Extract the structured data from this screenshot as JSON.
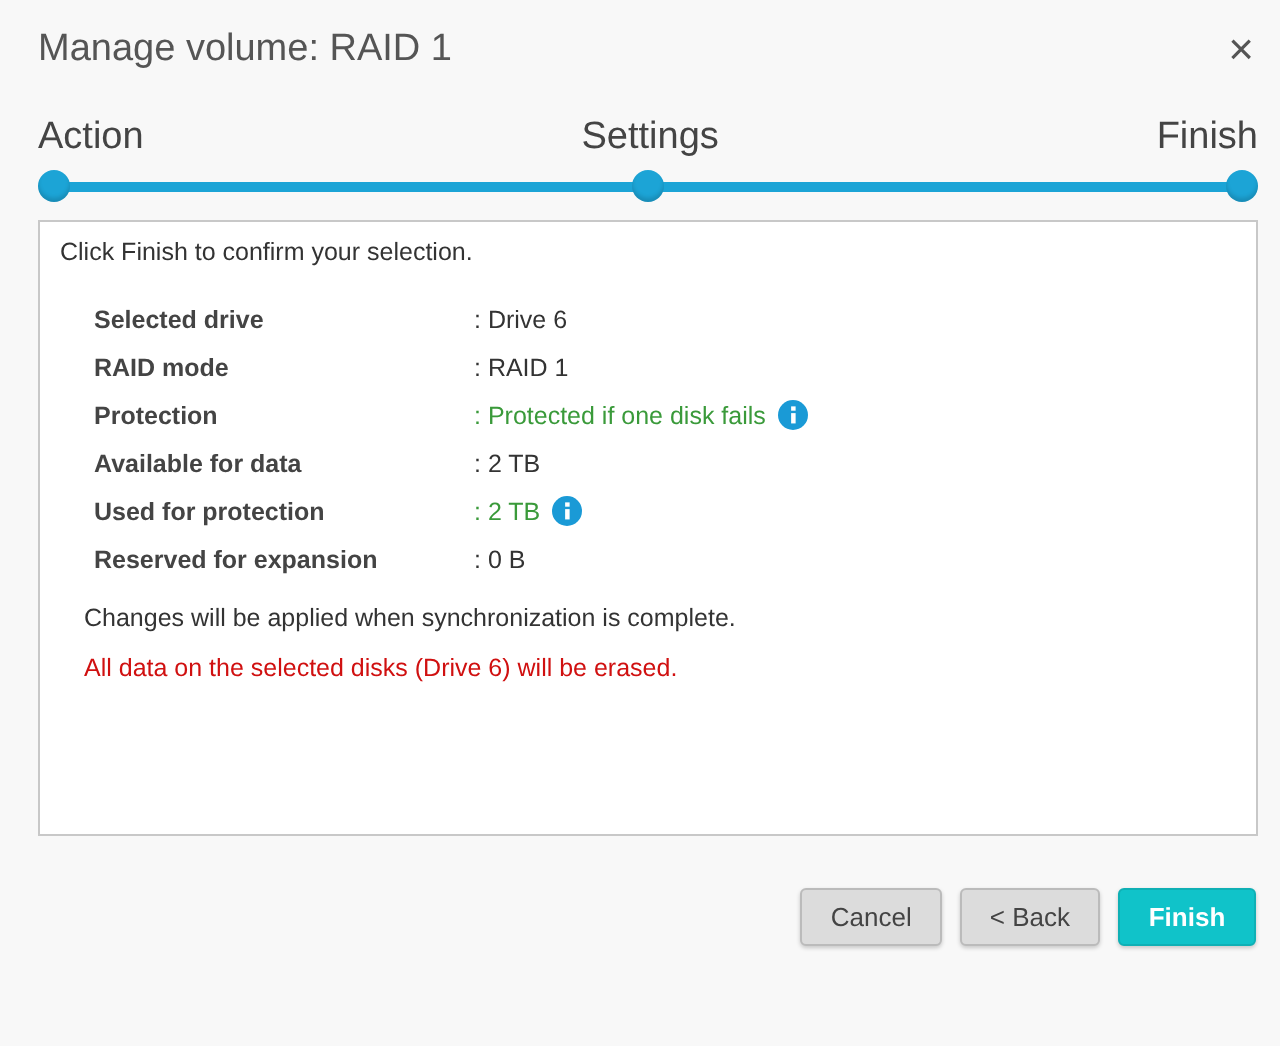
{
  "window": {
    "title": "Manage volume: RAID 1",
    "close": "×"
  },
  "steps": {
    "items": [
      {
        "label": "Action",
        "done": true
      },
      {
        "label": "Settings",
        "done": true
      },
      {
        "label": "Finish",
        "done": true
      }
    ]
  },
  "summary": {
    "intro": "Click Finish to confirm your selection.",
    "rows": [
      {
        "label": "Selected drive",
        "value": ": Drive 6",
        "highlighted": false,
        "info": false
      },
      {
        "label": "RAID mode",
        "value": ": RAID 1",
        "highlighted": false,
        "info": false
      },
      {
        "label": "Protection",
        "value": ": Protected if one disk fails",
        "highlighted": true,
        "info": true
      },
      {
        "label": "Available for data",
        "value": ": 2 TB",
        "highlighted": false,
        "info": false
      },
      {
        "label": "Used for protection",
        "value": ": 2 TB",
        "highlighted": true,
        "info": true
      },
      {
        "label": "Reserved for expansion",
        "value": ": 0 B",
        "highlighted": false,
        "info": false
      }
    ],
    "note": "Changes will be applied when synchronization is complete.",
    "warning": "All data on the selected disks (Drive 6) will be erased."
  },
  "buttons": [
    {
      "label": "Cancel",
      "kind": "secondary"
    },
    {
      "label": "< Back",
      "kind": "secondary"
    },
    {
      "label": "Finish",
      "kind": "primary"
    }
  ]
}
